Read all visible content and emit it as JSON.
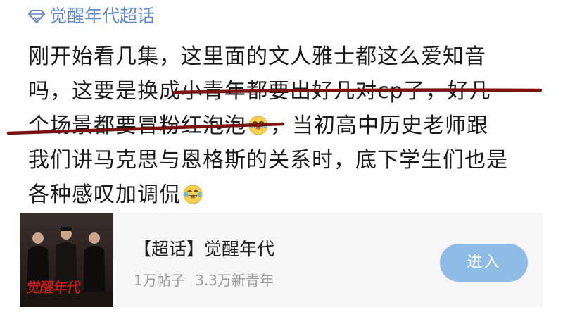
{
  "topic": {
    "name": "觉醒年代超话",
    "icon": "diamond-icon",
    "color": "#5e86c9"
  },
  "post": {
    "lines": [
      "刚开始看几集，这里面的文人雅士都这么爱知音",
      "吗，这要是换成小青年都要出好几对cp了，好几",
      "个场景都要冒粉红泡泡",
      "，当初高中历史老师跟",
      "我们讲马克思与恩格斯的关系时，底下学生们也是",
      "各种感叹加调侃"
    ],
    "emoji": "laugh-cry-emoji",
    "underline_color": "#7a1212"
  },
  "card": {
    "title": "【超话】觉醒年代",
    "stat_posts": "1万帖子",
    "stat_members": "3.3万新青年",
    "button_label": "进入",
    "button_color": "#8ebce6",
    "poster_text": "觉醒年代"
  }
}
